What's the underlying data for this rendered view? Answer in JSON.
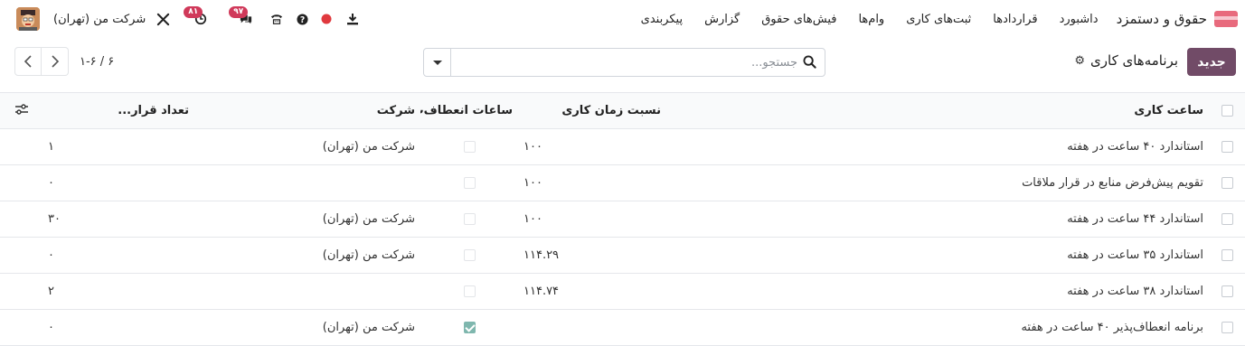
{
  "navbar": {
    "app_name": "حقوق و دستمزد",
    "menu": [
      "داشبورد",
      "قراردادها",
      "ثبت‌های کاری",
      "وام‌ها",
      "فیش‌های حقوق",
      "گزارش",
      "پیکربندی"
    ],
    "company": "شرکت من (تهران)",
    "badges": {
      "activities": "۸۱",
      "messages": "۹۷"
    },
    "icons": [
      "settings-tools-icon",
      "activity-clock-icon",
      "chat-icon",
      "phone-icon",
      "help-icon",
      "status-dot-icon",
      "download-icon"
    ]
  },
  "control": {
    "new_button": "جدید",
    "title": "برنامه‌های کاری",
    "search_placeholder": "جستجو...",
    "pager_value": "۱-۶ / ۶"
  },
  "table": {
    "headers": {
      "name": "ساعت کاری",
      "ratio": "نسبت زمان کاری",
      "flexible": "ساعات انعطاف‌پ...",
      "company": "شرکت",
      "contracts": "تعداد قرار..."
    },
    "rows": [
      {
        "name": "استاندارد ۴۰ ساعت در هفته",
        "ratio": "۱۰۰",
        "flexible": false,
        "company": "شرکت من (تهران)",
        "contracts": "۱"
      },
      {
        "name": "تقویم پیش‌فرض منابع در قرار ملاقات",
        "ratio": "۱۰۰",
        "flexible": false,
        "company": "",
        "contracts": "۰"
      },
      {
        "name": "استاندارد ۴۴ ساعت در هفته",
        "ratio": "۱۰۰",
        "flexible": false,
        "company": "شرکت من (تهران)",
        "contracts": "۳۰"
      },
      {
        "name": "استاندارد ۳۵ ساعت در هفته",
        "ratio": "۱۱۴.۲۹",
        "flexible": false,
        "company": "شرکت من (تهران)",
        "contracts": "۰"
      },
      {
        "name": "استاندارد ۳۸ ساعت در هفته",
        "ratio": "۱۱۴.۷۴",
        "flexible": false,
        "company": "",
        "contracts": "۲"
      },
      {
        "name": "برنامه انعطاف‌پذیر ۴۰ ساعت در هفته",
        "ratio": "",
        "flexible": true,
        "company": "شرکت من (تهران)",
        "contracts": "۰"
      }
    ]
  },
  "colors": {
    "brand": "#714b67",
    "badge": "#d0395a",
    "record_dot": "#e0393e",
    "check": "#7fb7ae"
  }
}
